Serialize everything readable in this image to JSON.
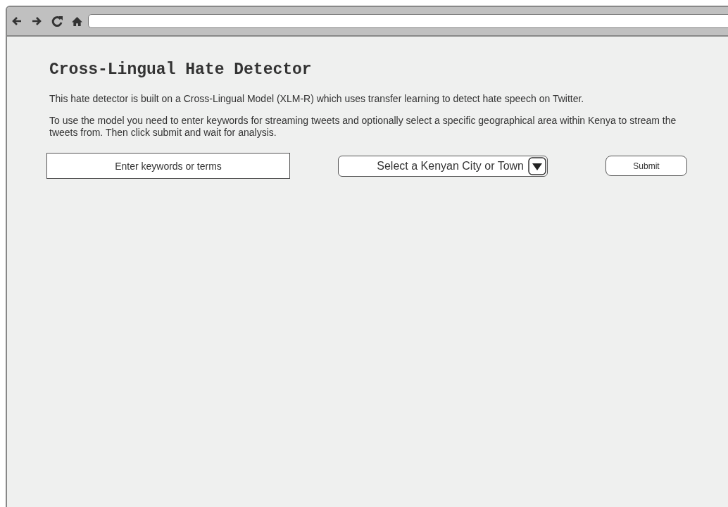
{
  "title": "Cross-Lingual Hate Detector",
  "paragraphs": [
    "This hate detector is built on a Cross-Lingual Model (XLM-R) which uses transfer learning to detect hate speech on Twitter.",
    "To use the model you need to enter keywords for streaming tweets and optionally select a specific geographical area within Kenya to stream the tweets from. Then click submit and wait for analysis."
  ],
  "keywords_field": {
    "placeholder": "Enter keywords or terms"
  },
  "location_select": {
    "value": "Select a Kenyan City or Town"
  },
  "submit_button": {
    "label": "Submit"
  }
}
